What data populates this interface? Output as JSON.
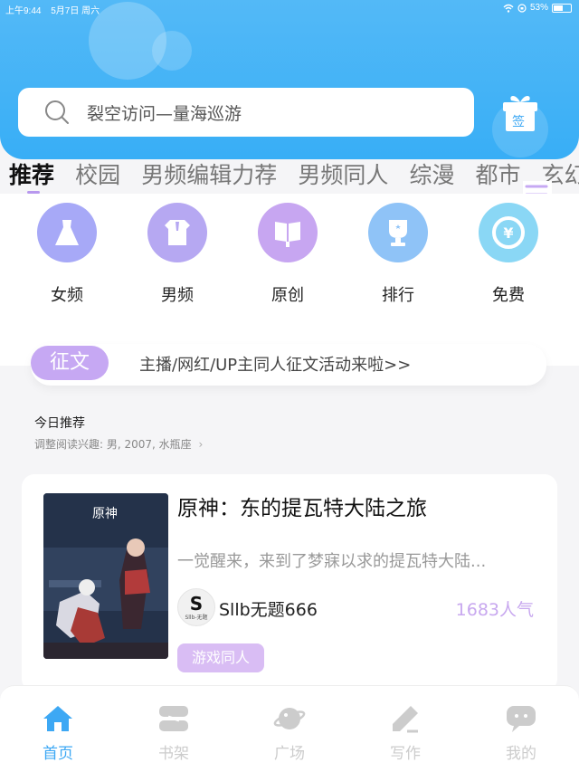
{
  "status": {
    "time": "上午9:44",
    "date": "5月7日 周六",
    "battery": "53%"
  },
  "search": {
    "placeholder": "裂空访问—量海巡游"
  },
  "gift": {
    "label": "签"
  },
  "tabs": [
    {
      "label": "推荐",
      "active": true
    },
    {
      "label": "校园"
    },
    {
      "label": "男频编辑力荐"
    },
    {
      "label": "男频同人"
    },
    {
      "label": "综漫"
    },
    {
      "label": "都市"
    },
    {
      "label": "玄幻"
    }
  ],
  "categories": [
    {
      "label": "女频",
      "icon": "dress-icon",
      "color": "#a7a9f7"
    },
    {
      "label": "男频",
      "icon": "shirt-icon",
      "color": "#b6a8f2"
    },
    {
      "label": "原创",
      "icon": "book-icon",
      "color": "#c7a6f1"
    },
    {
      "label": "排行",
      "icon": "trophy-icon",
      "color": "#8fc3f7"
    },
    {
      "label": "免费",
      "icon": "coin-icon",
      "color": "#8ad7f5"
    }
  ],
  "notice": {
    "pill": "征文",
    "text": "主播/网红/UP主同人征文活动来啦>>"
  },
  "section": {
    "title": "今日推荐",
    "subtitle": "调整阅读兴趣: 男, 2007, 水瓶座"
  },
  "book": {
    "cover_title": "原神",
    "title": "原神：东的提瓦特大陆之旅",
    "description": "一觉醒来，来到了梦寐以求的提瓦特大陆...",
    "avatar_letter": "S",
    "avatar_text": "Sllb-无题",
    "author": "Sllb无题666",
    "popularity": "1683人气",
    "tag": "游戏同人"
  },
  "nav": [
    {
      "label": "首页",
      "icon": "home-icon",
      "active": true
    },
    {
      "label": "书架",
      "icon": "bookshelf-icon"
    },
    {
      "label": "广场",
      "icon": "planet-icon"
    },
    {
      "label": "写作",
      "icon": "pencil-icon"
    },
    {
      "label": "我的",
      "icon": "chat-icon"
    }
  ],
  "colors": {
    "primary": "#3da8f4",
    "accent": "#c6a8f3",
    "inactive": "#cccccc"
  }
}
